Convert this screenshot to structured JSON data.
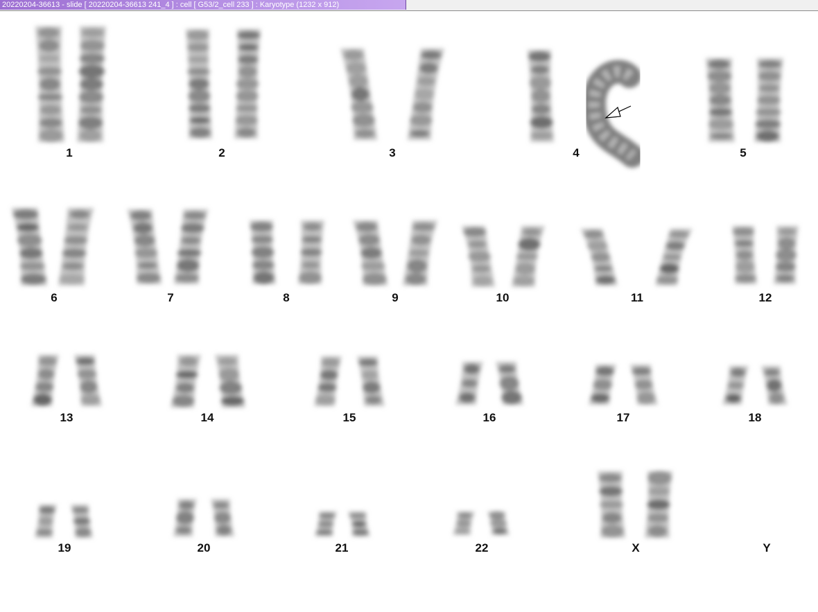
{
  "window": {
    "title": "20220204-36613 - slide [ 20220204-36613 241_4 ] : cell [ G53/2_cell 233 ] : Karyotype  (1232 x 912)"
  },
  "karyotype": {
    "chromosome_labels": [
      "1",
      "2",
      "3",
      "4",
      "5",
      "6",
      "7",
      "8",
      "9",
      "10",
      "11",
      "12",
      "13",
      "14",
      "15",
      "16",
      "17",
      "18",
      "19",
      "20",
      "21",
      "22",
      "X",
      "Y"
    ],
    "abnormality_marker": {
      "chromosome": "4",
      "icon": "arrow-icon"
    }
  }
}
